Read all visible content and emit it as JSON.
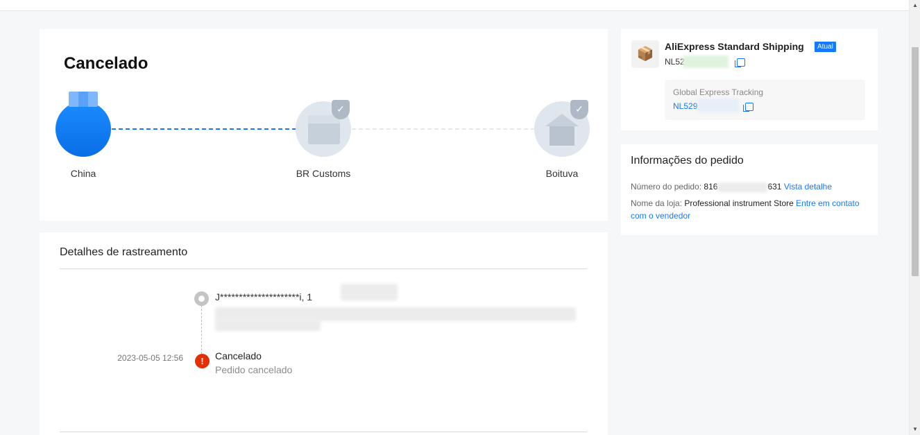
{
  "progress": {
    "status_title": "Cancelado",
    "steps": [
      {
        "label": "China",
        "state": "active",
        "icon": "package-box-icon"
      },
      {
        "label": "BR Customs",
        "state": "pending",
        "icon": "customs-box-icon"
      },
      {
        "label": "Boituva",
        "state": "pending",
        "icon": "house-icon"
      }
    ],
    "colors": {
      "active": "#1677ff",
      "pending": "#dfe6ee"
    }
  },
  "tracking": {
    "title": "Detalhes de rastreamento",
    "address": {
      "name_masked": "J*********************i,  1"
    },
    "events": [
      {
        "time": "2023-05-05 12:56",
        "title": "Cancelado",
        "description": "Pedido cancelado",
        "icon": "alert-icon"
      }
    ]
  },
  "shipping": {
    "carrier_name": "AliExpress Standard Shipping",
    "badge": "Atual",
    "tracking_number": "NL52",
    "global": {
      "label": "Global Express Tracking",
      "number": "NL529"
    }
  },
  "order": {
    "title": "Informações do pedido",
    "number_label": "Número do pedido:",
    "number_prefix": "816",
    "number_suffix": "631",
    "view_detail_link": "Vista detalhe",
    "store_label": "Nome da loja:",
    "store_name": "Professional instrument Store",
    "contact_link": "Entre em contato com o vendedor"
  }
}
